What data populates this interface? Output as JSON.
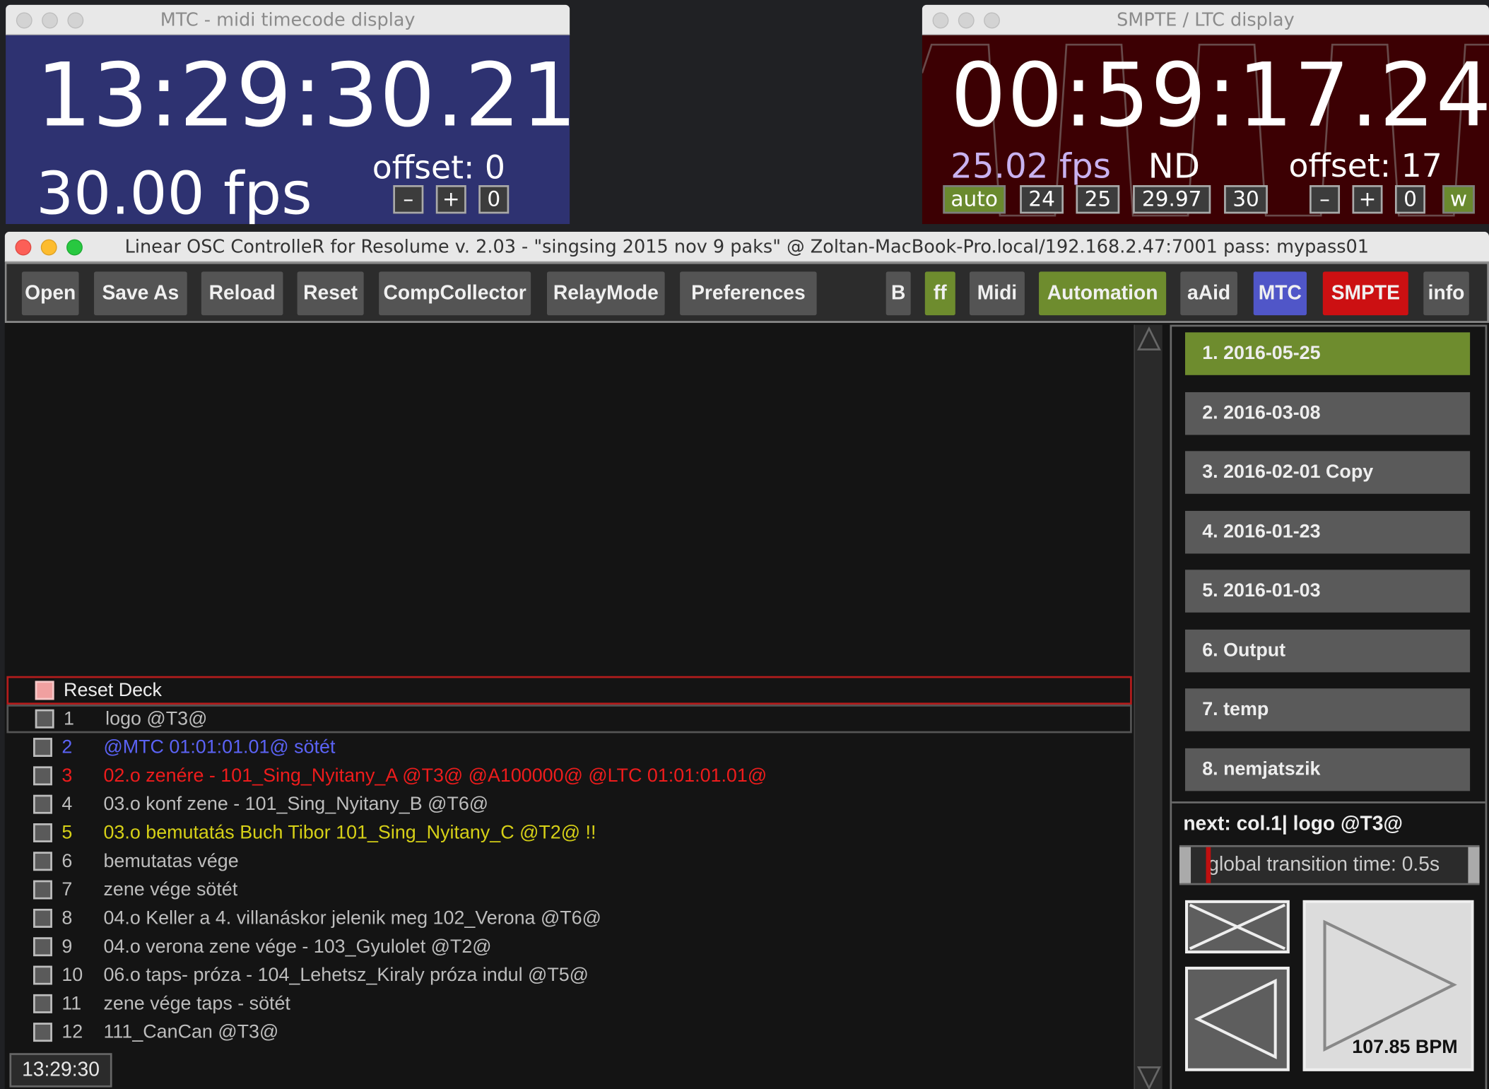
{
  "mtc": {
    "title": "MTC - midi timecode display",
    "timecode": "13:29:30.21",
    "fps": "30.00 fps",
    "offset": "offset: 0",
    "buttons": [
      "–",
      "+",
      "0"
    ]
  },
  "smpte": {
    "title": "SMPTE / LTC  display",
    "timecode": "00:59:17.24",
    "fps": "25.02 fps",
    "mode": "ND",
    "offset": "offset: 17",
    "rate_buttons": [
      "auto",
      "24",
      "25",
      "29.97",
      "30"
    ],
    "offset_buttons": [
      "–",
      "+",
      "0"
    ],
    "w_button": "w"
  },
  "main": {
    "title": "Linear OSC ControlleR for Resolume  v. 2.03  - \"singsing 2015 nov 9 paks\" @ Zoltan-MacBook-Pro.local/192.168.2.47:7001 pass: mypass01",
    "toolbar": {
      "open": "Open",
      "save_as": "Save As",
      "reload": "Reload",
      "reset": "Reset",
      "comp_collector": "CompCollector",
      "relay_mode": "RelayMode",
      "preferences": "Preferences",
      "b": "B",
      "ff": "ff",
      "midi": "Midi",
      "automation": "Automation",
      "aaid": "aAid",
      "mtc": "MTC",
      "smpte": "SMPTE",
      "info": "info"
    },
    "reset_deck": "Reset Deck",
    "cues": [
      {
        "num": "1",
        "text": "logo @T3@"
      },
      {
        "num": "2",
        "text": "@MTC 01:01:01.01@ sötét"
      },
      {
        "num": "3",
        "text": "02.o zenére - 101_Sing_Nyitany_A @T3@  @A100000@  @LTC 01:01:01.01@"
      },
      {
        "num": "4",
        "text": "03.o konf zene - 101_Sing_Nyitany_B @T6@"
      },
      {
        "num": "5",
        "text": "03.o bemutatás Buch Tibor 101_Sing_Nyitany_C @T2@ !!"
      },
      {
        "num": "6",
        "text": "bemutatas vége"
      },
      {
        "num": "7",
        "text": "zene vége sötét"
      },
      {
        "num": "8",
        "text": "04.o Keller a 4. villanáskor jelenik meg 102_Verona @T6@"
      },
      {
        "num": "9",
        "text": "04.o verona zene vége  - 103_Gyulolet @T2@"
      },
      {
        "num": "10",
        "text": "06.o taps- próza - 104_Lehetsz_Kiraly próza indul @T5@"
      },
      {
        "num": "11",
        "text": "zene vége taps - sötét"
      },
      {
        "num": "12",
        "text": "111_CanCan @T3@"
      }
    ],
    "cue_colors": {
      "2": "#5b63f5",
      "3": "#ee1c1c",
      "5": "#d6d017"
    },
    "compositions": [
      "1. 2016-05-25",
      "2. 2016-03-08",
      "3. 2016-02-01 Copy",
      "4. 2016-01-23",
      "5. 2016-01-03",
      "6. Output",
      "7. temp",
      "8. nemjatszik"
    ],
    "next": "next: col.1| logo @T3@",
    "transition": "global transition time: 0.5s",
    "bpm": "107.85 BPM",
    "status_time": "13:29:30"
  }
}
